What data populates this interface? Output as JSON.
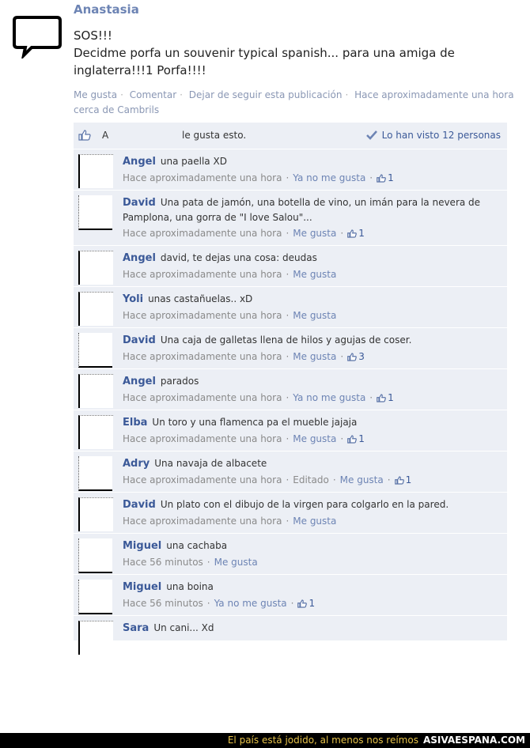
{
  "post": {
    "author": "Anastasia",
    "text": "SOS!!!\nDecidme porfa un souvenir typical spanish... para una amiga de inglaterra!!!1 Porfa!!!!",
    "actions": [
      "Me gusta",
      "Comentar",
      "Dejar de seguir esta publicación"
    ],
    "time": "Hace aproximadamente una hora cerca de Cambrils"
  },
  "likes": {
    "a": "A",
    "rest": "le gusta esto.",
    "seen": "Lo han visto 12 personas"
  },
  "comments": [
    {
      "name": "Angel",
      "text": "una paella XD",
      "time": "Hace aproximadamente una hora",
      "action": "Ya no me gusta",
      "likes": "1"
    },
    {
      "name": "David",
      "text": "Una pata de jamón, una botella de vino, un imán para la nevera de Pamplona, una gorra de \"I love Salou\"...",
      "time": "Hace aproximadamente una hora",
      "action": "Me gusta",
      "likes": "1"
    },
    {
      "name": "Angel",
      "text": "david, te dejas una cosa: deudas",
      "time": "Hace aproximadamente una hora",
      "action": "Me gusta",
      "likes": ""
    },
    {
      "name": "Yoli",
      "text": "unas castañuelas.. xD",
      "time": "Hace aproximadamente una hora",
      "action": "Me gusta",
      "likes": ""
    },
    {
      "name": "David",
      "text": "Una caja de galletas llena de hilos y agujas de coser.",
      "time": "Hace aproximadamente una hora",
      "action": "Me gusta",
      "likes": "3"
    },
    {
      "name": "Angel",
      "text": "parados",
      "time": "Hace aproximadamente una hora",
      "action": "Ya no me gusta",
      "likes": "1"
    },
    {
      "name": "Elba",
      "text": "Un toro y una flamenca pa el mueble jajaja",
      "time": "Hace aproximadamente una hora",
      "action": "Me gusta",
      "likes": "1"
    },
    {
      "name": "Adry",
      "text": "Una navaja de albacete",
      "time": "Hace aproximadamente una hora",
      "edited": "Editado",
      "action": "Me gusta",
      "likes": "1"
    },
    {
      "name": "David",
      "text": "Un plato con el dibujo de la virgen para colgarlo en la pared.",
      "time": "Hace aproximadamente una hora",
      "action": "Me gusta",
      "likes": ""
    },
    {
      "name": "Miguel",
      "text": "una cachaba",
      "time": "Hace 56 minutos",
      "action": "Me gusta",
      "likes": ""
    },
    {
      "name": "Miguel",
      "text": "una boina",
      "time": "Hace 56 minutos",
      "action": "Ya no me gusta",
      "likes": "1"
    },
    {
      "name": "Sara",
      "text": "Un cani... Xd",
      "time": "",
      "action": "",
      "likes": ""
    }
  ],
  "footer": {
    "slogan": "El país está jodido, al menos nos reímos",
    "brand": "ASIVAESPANA.COM"
  },
  "icons": {
    "profile": "speech-bubble-icon",
    "like": "thumbs-up-icon",
    "seen": "checkmark-icon"
  }
}
